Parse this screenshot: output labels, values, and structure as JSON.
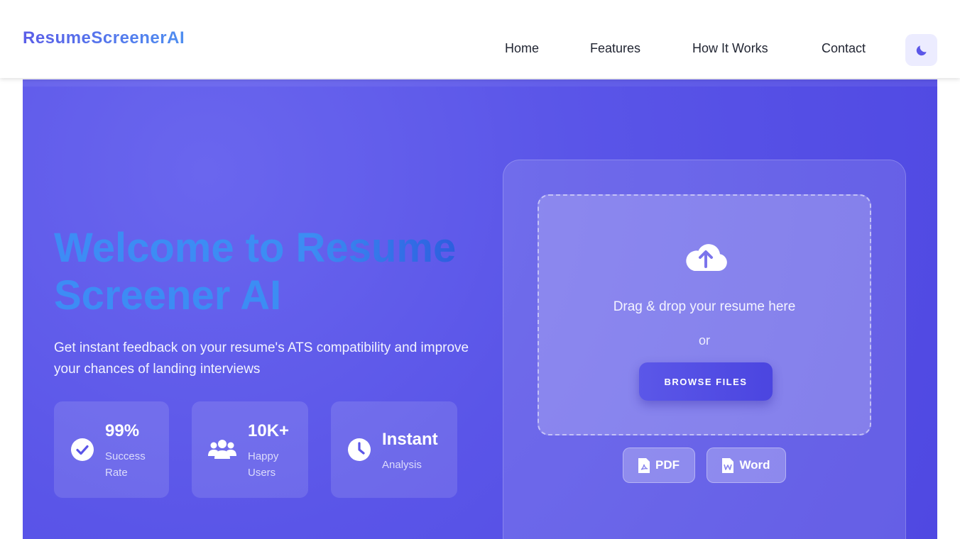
{
  "brand": {
    "logo": "ResumeScreenerAI"
  },
  "nav": {
    "items": [
      {
        "label": "Home"
      },
      {
        "label": "Features"
      },
      {
        "label": "How It Works"
      },
      {
        "label": "Contact"
      }
    ],
    "theme_icon": "moon-icon"
  },
  "hero": {
    "title": "Welcome to Resume Screener AI",
    "subtitle": "Get instant feedback on your resume's ATS compatibility and improve your chances of landing interviews",
    "stats": [
      {
        "icon": "check-circle-icon",
        "value": "99%",
        "label": "Success Rate"
      },
      {
        "icon": "users-icon",
        "value": "10K+",
        "label": "Happy Users"
      },
      {
        "icon": "clock-icon",
        "value": "Instant",
        "label": "Analysis"
      }
    ]
  },
  "upload": {
    "icon": "cloud-upload-icon",
    "drop_text": "Drag & drop your resume here",
    "or_text": "or",
    "browse_label": "BROWSE FILES",
    "formats": [
      {
        "icon": "pdf-file-icon",
        "label": "PDF"
      },
      {
        "icon": "word-file-icon",
        "label": "Word"
      }
    ]
  },
  "colors": {
    "hero_bg": "#5a55e8",
    "accent": "#4f48e2",
    "title_gradient_start": "#3d8cf5",
    "title_gradient_end": "#2a56db"
  }
}
